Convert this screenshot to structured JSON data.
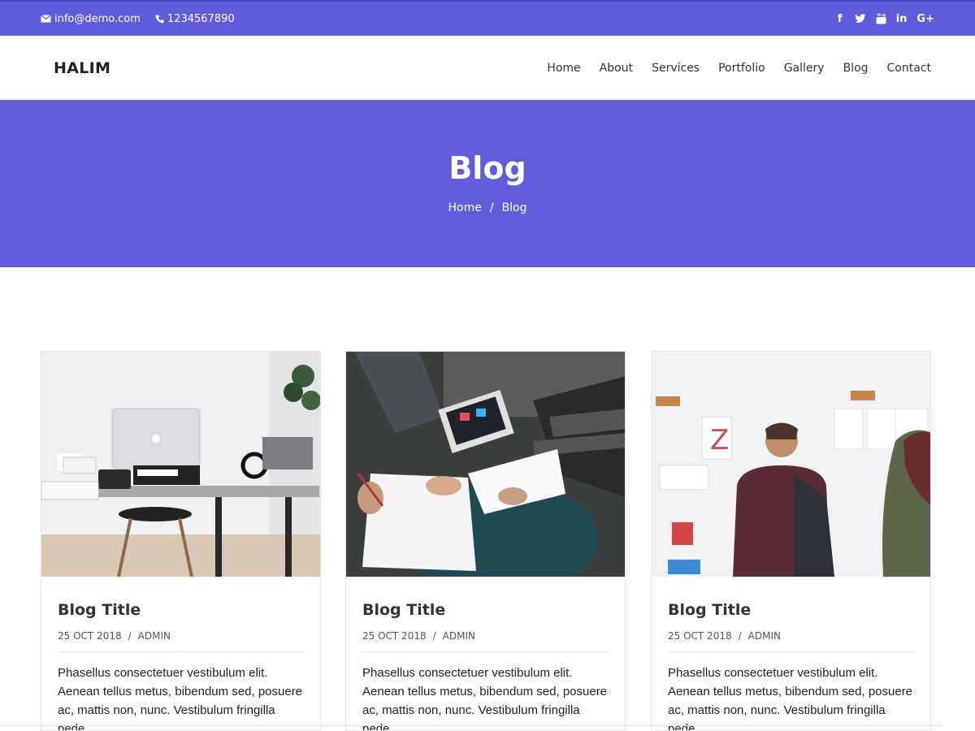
{
  "topbar": {
    "email": "info@demo.com",
    "phone": "1234567890",
    "social": [
      {
        "name": "facebook-icon",
        "glyph": "f"
      },
      {
        "name": "twitter-icon",
        "glyph": "t"
      },
      {
        "name": "youtube-icon",
        "glyph": "▶"
      },
      {
        "name": "linkedin-icon",
        "glyph": "in"
      },
      {
        "name": "google-plus-icon",
        "glyph": "G+"
      }
    ]
  },
  "brand": "HALIM",
  "nav": [
    "Home",
    "About",
    "Services",
    "Portfolio",
    "Gallery",
    "Blog",
    "Contact"
  ],
  "hero": {
    "title": "Blog",
    "breadcrumb": {
      "home": "Home",
      "separator": "/",
      "current": "Blog"
    }
  },
  "posts": [
    {
      "title": "Blog Title",
      "date": "25 OCT 2018",
      "author": "ADMIN",
      "excerpt": "Phasellus consectetuer vestibulum elit. Aenean tellus metus, bibendum sed, posuere ac, mattis non, nunc. Vestibulum fringilla pede"
    },
    {
      "title": "Blog Title",
      "date": "25 OCT 2018",
      "author": "ADMIN",
      "excerpt": "Phasellus consectetuer vestibulum elit. Aenean tellus metus, bibendum sed, posuere ac, mattis non, nunc. Vestibulum fringilla pede"
    },
    {
      "title": "Blog Title",
      "date": "25 OCT 2018",
      "author": "ADMIN",
      "excerpt": "Phasellus consectetuer vestibulum elit. Aenean tellus metus, bibendum sed, posuere ac, mattis non, nunc. Vestibulum fringilla pede"
    }
  ],
  "colors": {
    "accent": "#605bdb",
    "hero": "#625cdc"
  }
}
